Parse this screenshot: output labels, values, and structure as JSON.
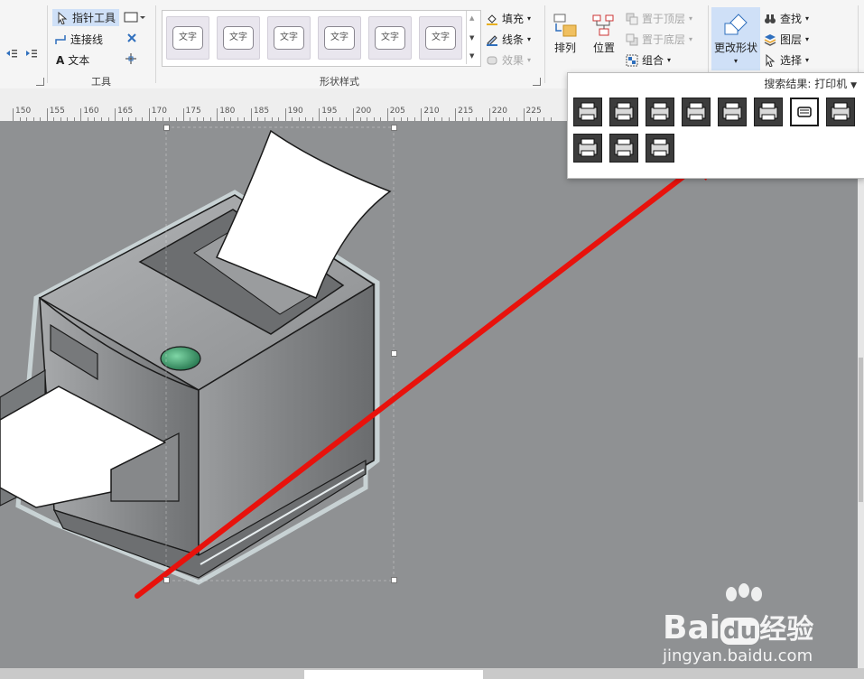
{
  "ribbon": {
    "tools_group": {
      "label": "工具",
      "pointer_tool": "指针工具",
      "connector": "连接线",
      "text": "文本"
    },
    "shape_styles_group": {
      "label": "形状样式",
      "thumb_text": "文字"
    },
    "format_buttons": {
      "fill": "填充",
      "line": "线条",
      "effects": "效果"
    },
    "arrange_group": {
      "arrange": "排列",
      "position": "位置",
      "bring_front": "置于顶层",
      "send_back": "置于底层",
      "group": "组合"
    },
    "change_shape": "更改形状",
    "editing": {
      "find": "查找",
      "layers": "图层",
      "select": "选择"
    }
  },
  "ruler": {
    "ticks": [
      "150",
      "155",
      "160",
      "165",
      "170",
      "175",
      "180",
      "185",
      "190",
      "195",
      "200",
      "205",
      "210",
      "215",
      "220",
      "225"
    ]
  },
  "popup": {
    "title": "搜索结果: 打印机",
    "icons": [
      "printer-1-icon",
      "printer-2-icon",
      "printer-3-icon",
      "fax-icon",
      "tower-icon",
      "scanner-icon",
      "printer-selected-icon",
      "flatbed-icon",
      "printer-4-icon",
      "printer-5-icon",
      "printer-tray-icon"
    ]
  },
  "watermark": {
    "brand": "Bai",
    "brand2": "du",
    "suffix": "经验",
    "url": "jingyan.baidu.com"
  },
  "colors": {
    "arrow": "#e8120c",
    "accent": "#2f6fbd",
    "selected_button": "#cfe0f7"
  }
}
